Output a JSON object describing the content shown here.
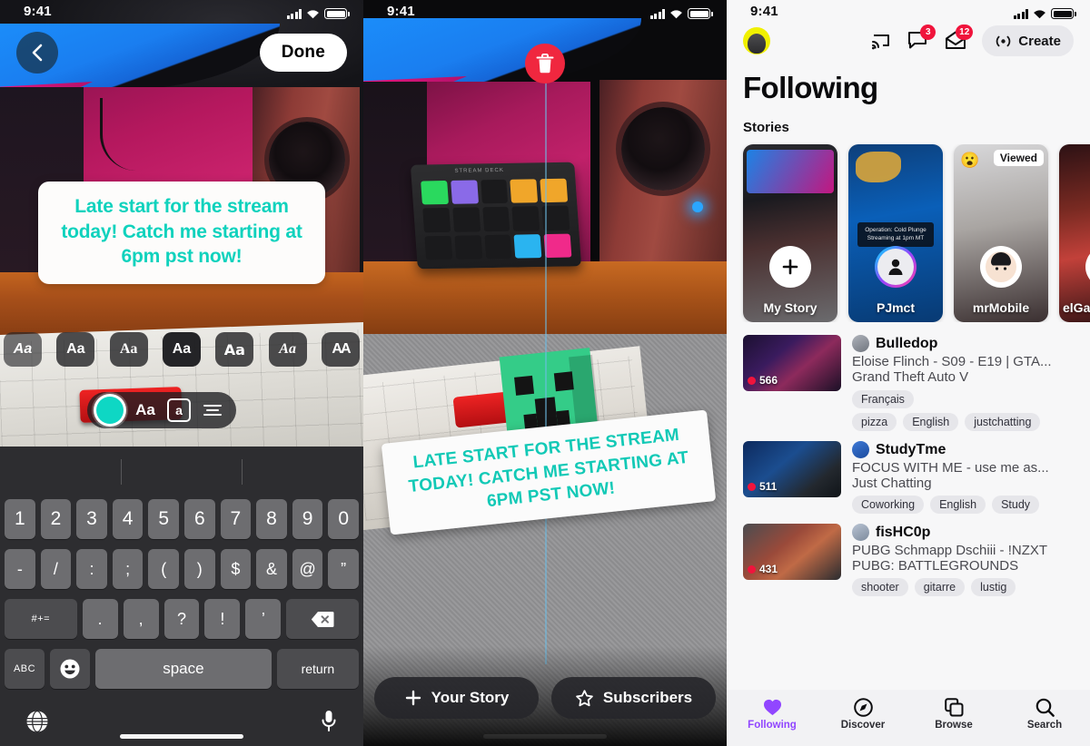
{
  "statusbar": {
    "time": "9:41"
  },
  "editor": {
    "back_icon": "chevron-left-icon",
    "done_label": "Done",
    "text_overlay": "Late start for the stream today! Catch me starting at 6pm pst now!",
    "text_color": "#0fd2bd",
    "font_options": [
      {
        "label": "Aa",
        "name": "font-style-italic"
      },
      {
        "label": "Aa",
        "name": "font-style-sans"
      },
      {
        "label": "Aa",
        "name": "font-style-serif"
      },
      {
        "label": "Aa",
        "name": "font-style-bold"
      },
      {
        "label": "Aa",
        "name": "font-style-rounded"
      },
      {
        "label": "Aa",
        "name": "font-style-script"
      },
      {
        "label": "AA",
        "name": "font-style-condensed"
      }
    ],
    "tools": {
      "color_swatch": "#0ed7c4",
      "text_size_label": "Aa",
      "highlight_label": "a",
      "align_icon": "align-lines-icon"
    },
    "keyboard": {
      "row1": [
        "1",
        "2",
        "3",
        "4",
        "5",
        "6",
        "7",
        "8",
        "9",
        "0"
      ],
      "row2": [
        "-",
        "/",
        ":",
        ";",
        "(",
        ")",
        "$",
        "&",
        "@",
        "”"
      ],
      "row3_modifier": "#+=",
      "row3": [
        ".",
        ",",
        "?",
        "!",
        "’"
      ],
      "row3_delete": "delete-icon",
      "row4_abc": "ABC",
      "row4_emoji": "emoji-icon",
      "row4_space": "space",
      "row4_return": "return",
      "globe_icon": "globe-icon",
      "mic_icon": "microphone-icon"
    }
  },
  "preview": {
    "trash_icon": "trash-icon",
    "sticker_text": "Late start for the stream today! Catch me starting at 6pm pst now!",
    "sticker_color": "#12c9b6",
    "buttons": [
      {
        "label": "Your Story",
        "icon": "plus-icon"
      },
      {
        "label": "Subscribers",
        "icon": "star-icon"
      }
    ]
  },
  "following": {
    "header": {
      "avatar": "user-avatar",
      "cast_icon": "cast-icon",
      "chat_icon": "chat-bubble-icon",
      "chat_badge": "3",
      "mail_icon": "mail-icon",
      "mail_badge": "12",
      "create_label": "Create",
      "create_icon": "broadcast-icon"
    },
    "page_title": "Following",
    "stories_header": "Stories",
    "stories": [
      {
        "name": "My Story",
        "action_icon": "plus-icon",
        "viewed": ""
      },
      {
        "name": "PJmct",
        "action_icon": "person-icon",
        "viewed": "",
        "overlay": "Operation: Cold Plunge Streaming at 1pm MT"
      },
      {
        "name": "mrMobile",
        "action_icon": "avatar-icon",
        "viewed": "Viewed",
        "emoji": "😮"
      },
      {
        "name": "elGato",
        "action_icon": "avatar-icon",
        "viewed": ""
      }
    ],
    "videos": [
      {
        "channel": "Bulledop",
        "title": "Eloise Flinch - S09 - E19  | GTA...",
        "game": "Grand Theft Auto V",
        "viewers": "566",
        "tags_row1": [
          "Français"
        ],
        "tags_row2": [
          "pizza",
          "English",
          "justchatting"
        ]
      },
      {
        "channel": "StudyTme",
        "title": "FOCUS WITH ME - use me as...",
        "game": "Just Chatting",
        "viewers": "511",
        "tags_row1": [],
        "tags_row2": [
          "Coworking",
          "English",
          "Study"
        ]
      },
      {
        "channel": "fisHC0p",
        "title": "PUBG Schmapp Dschiii - !NZXT",
        "game": "PUBG: BATTLEGROUNDS",
        "viewers": "431",
        "tags_row1": [],
        "tags_row2": [
          "shooter",
          "gitarre",
          "lustig"
        ]
      }
    ],
    "nav": [
      {
        "label": "Following",
        "icon": "heart-icon",
        "active": true
      },
      {
        "label": "Discover",
        "icon": "compass-icon",
        "active": false
      },
      {
        "label": "Browse",
        "icon": "browse-icon",
        "active": false
      },
      {
        "label": "Search",
        "icon": "search-icon",
        "active": false
      }
    ],
    "accent_color": "#9146ff"
  }
}
